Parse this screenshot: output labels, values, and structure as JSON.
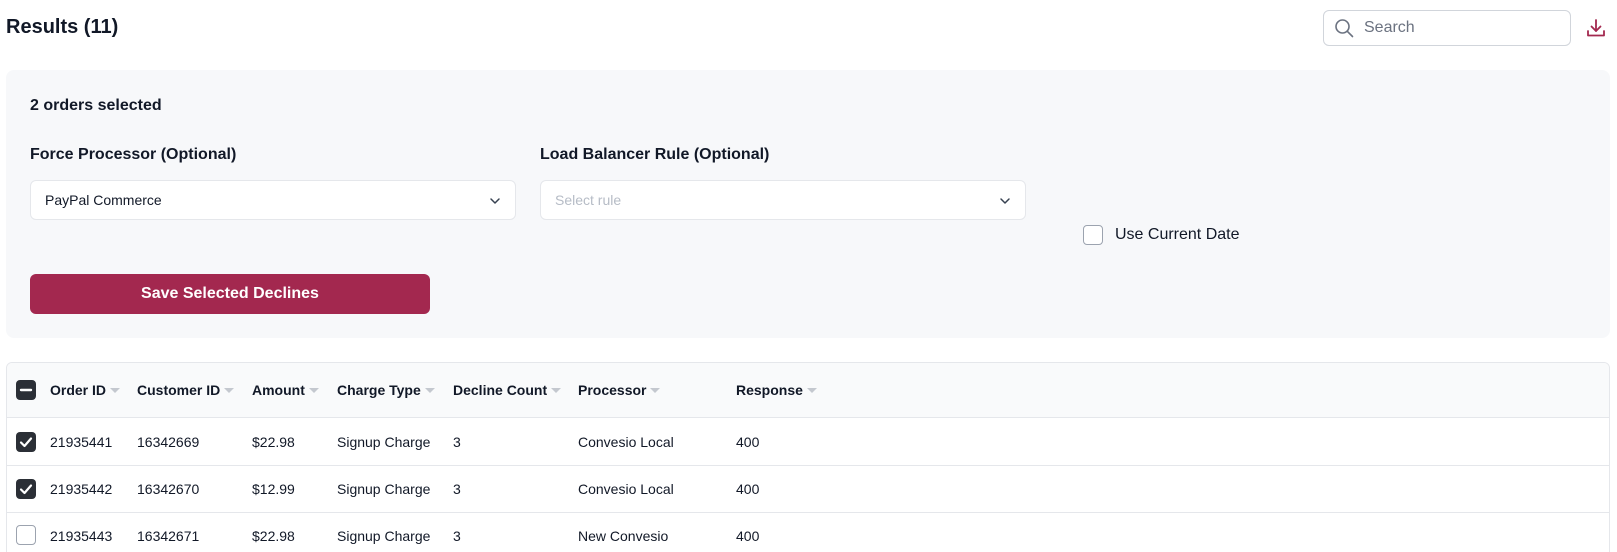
{
  "header": {
    "title": "Results (11)",
    "search_placeholder": "Search"
  },
  "panel": {
    "selected_count": "2 orders selected",
    "force_processor": {
      "label": "Force Processor (Optional)",
      "value": "PayPal Commerce"
    },
    "load_balancer": {
      "label": "Load Balancer Rule (Optional)",
      "placeholder": "Select rule"
    },
    "use_current_date": {
      "label": "Use Current Date",
      "checked": false
    },
    "save_label": "Save Selected Declines"
  },
  "table": {
    "columns": [
      "Order ID",
      "Customer ID",
      "Amount",
      "Charge Type",
      "Decline Count",
      "Processor",
      "Response"
    ],
    "rows": [
      {
        "selected": true,
        "order_id": "21935441",
        "customer_id": "16342669",
        "amount": "$22.98",
        "charge_type": "Signup Charge",
        "decline_count": "3",
        "processor": "Convesio Local",
        "response": "400"
      },
      {
        "selected": true,
        "order_id": "21935442",
        "customer_id": "16342670",
        "amount": "$12.99",
        "charge_type": "Signup Charge",
        "decline_count": "3",
        "processor": "Convesio Local",
        "response": "400"
      },
      {
        "selected": false,
        "order_id": "21935443",
        "customer_id": "16342671",
        "amount": "$22.98",
        "charge_type": "Signup Charge",
        "decline_count": "3",
        "processor": "New Convesio",
        "response": "400"
      }
    ]
  },
  "colors": {
    "accent": "#a3284f",
    "checkbox_dark": "#2b2f36"
  },
  "icons": {
    "search": "search-icon",
    "download": "download-icon",
    "chevron": "chevron-down-icon",
    "sort": "sort-icon"
  }
}
